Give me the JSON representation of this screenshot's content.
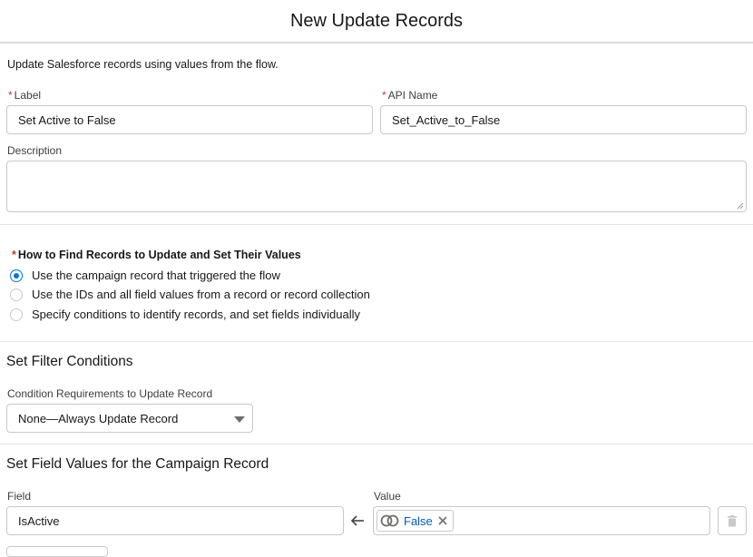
{
  "modal": {
    "title": "New Update Records"
  },
  "intro": "Update Salesforce records using values from the flow.",
  "label_field": {
    "label": "Label",
    "required_mark": "*",
    "value": "Set Active to False"
  },
  "api_name_field": {
    "label": "API Name",
    "required_mark": "*",
    "value": "Set_Active_to_False"
  },
  "description_field": {
    "label": "Description",
    "value": ""
  },
  "how_to_find": {
    "required_mark": "*",
    "heading": "How to Find Records to Update and Set Their Values",
    "options": [
      {
        "label": "Use the campaign record that triggered the flow",
        "selected": true
      },
      {
        "label": "Use the IDs and all field values from a record or record collection",
        "selected": false
      },
      {
        "label": "Specify conditions to identify records, and set fields individually",
        "selected": false
      }
    ]
  },
  "filter_conditions": {
    "title": "Set Filter Conditions",
    "requirement_label": "Condition Requirements to Update Record",
    "requirement_value": "None—Always Update Record"
  },
  "field_values": {
    "title": "Set Field Values for the Campaign Record",
    "field_header": "Field",
    "value_header": "Value",
    "rows": [
      {
        "field": "IsActive",
        "value_pill": "False",
        "value_icon": "toggle-icon"
      }
    ]
  },
  "colors": {
    "accent": "#0176d3",
    "required": "#c23934",
    "border": "#c9c9c9",
    "pill_text": "#0b5cab"
  }
}
